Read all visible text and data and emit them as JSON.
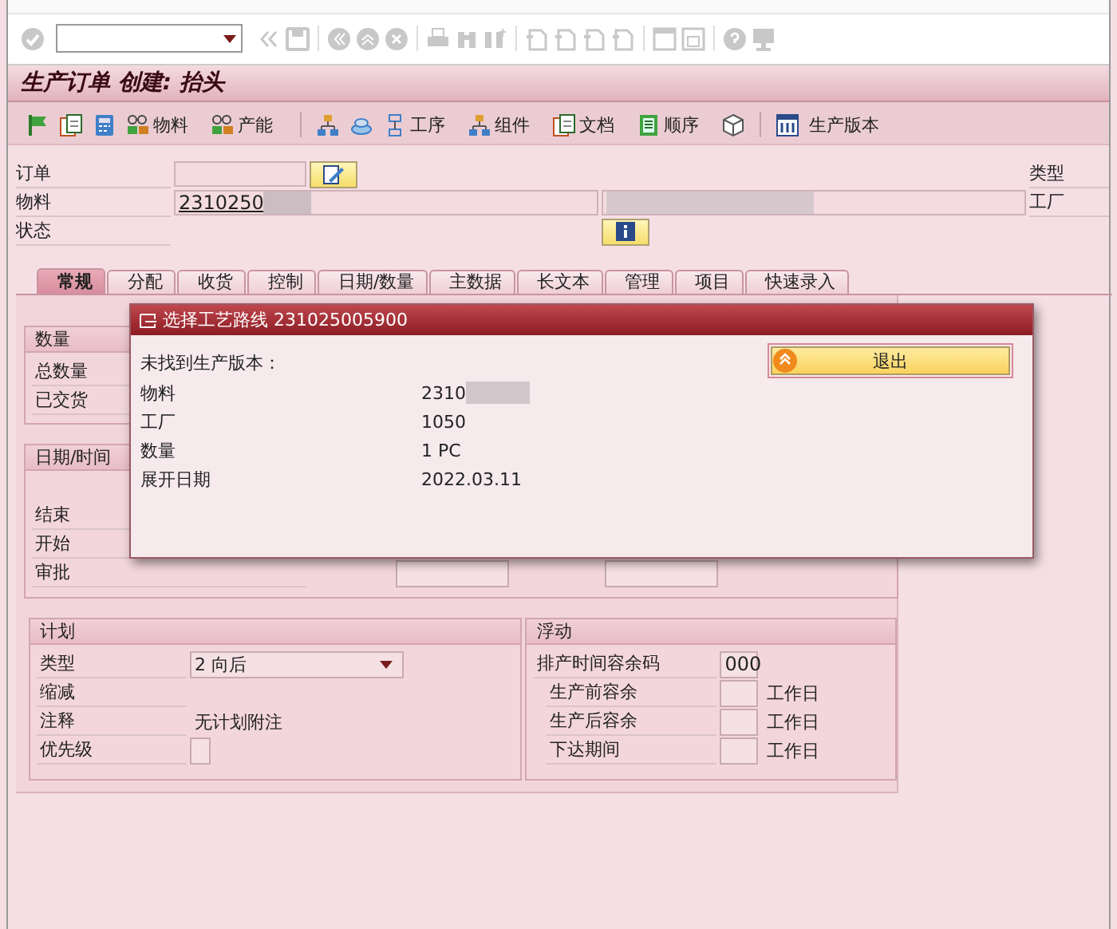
{
  "window": {
    "title": "生产订单 创建: 抬头"
  },
  "app_toolbar": [
    {
      "kind": "icon"
    },
    {
      "kind": "icon"
    },
    {
      "kind": "icon"
    },
    {
      "kind": "button",
      "label": "物料"
    },
    {
      "kind": "button",
      "label": "产能"
    },
    {
      "kind": "separator"
    },
    {
      "kind": "icon"
    },
    {
      "kind": "icon"
    },
    {
      "kind": "button",
      "label": "工序"
    },
    {
      "kind": "button",
      "label": "组件"
    },
    {
      "kind": "button",
      "label": "文档"
    },
    {
      "kind": "button",
      "label": "顺序"
    },
    {
      "kind": "icon"
    },
    {
      "kind": "separator"
    },
    {
      "kind": "icon"
    },
    {
      "kind": "button",
      "label": "生产版本"
    }
  ],
  "header": {
    "order_label": "订单",
    "material_label": "物料",
    "material_value": "2310250",
    "status_label": "状态",
    "right_labels": [
      "类型",
      "工厂"
    ]
  },
  "tabs": [
    {
      "label": "常规",
      "selected": true
    },
    {
      "label": "分配",
      "selected": false
    },
    {
      "label": "收货",
      "selected": false
    },
    {
      "label": "控制",
      "selected": false
    },
    {
      "label": "日期/数量",
      "selected": false
    },
    {
      "label": "主数据",
      "selected": false
    },
    {
      "label": "长文本",
      "selected": false
    },
    {
      "label": "管理",
      "selected": false
    },
    {
      "label": "项目",
      "selected": false
    },
    {
      "label": "快速录入",
      "selected": false
    }
  ],
  "quantity_group": {
    "title": "数量",
    "rows": [
      "总数量",
      "已交货"
    ]
  },
  "dates_group": {
    "title": "日期/时间",
    "rows": [
      {
        "label": "结束",
        "kind": "label"
      },
      {
        "label": "开始",
        "kind": "label"
      },
      {
        "label": "审批",
        "kind": "fields"
      }
    ]
  },
  "plan_group": {
    "title": "计划",
    "rows": [
      {
        "label": "类型",
        "kind": "dropdown",
        "value": "2 向后"
      },
      {
        "label": "缩减",
        "kind": "label"
      },
      {
        "label": "注释",
        "kind": "text",
        "value": "无计划附注"
      },
      {
        "label": "优先级",
        "kind": "field"
      }
    ]
  },
  "float_group": {
    "title": "浮动",
    "rows": [
      {
        "label": "排产时间容余码",
        "kind": "field",
        "value": "000"
      },
      {
        "label": "生产前容余",
        "kind": "unit",
        "unit": "工作日"
      },
      {
        "label": "生产后容余",
        "kind": "unit",
        "unit": "工作日"
      },
      {
        "label": "下达期间",
        "kind": "unit",
        "unit": "工作日"
      }
    ]
  },
  "dialog": {
    "title": "选择工艺路线 231025005900",
    "message": "未找到生产版本：",
    "rows": [
      {
        "label": "物料",
        "value": "2310",
        "blurred": true
      },
      {
        "label": "工厂",
        "value": "1050",
        "blurred": false
      },
      {
        "label": "数量",
        "value": "1 PC",
        "blurred": false
      },
      {
        "label": "展开日期",
        "value": "2022.03.11",
        "blurred": false
      }
    ],
    "exit_button": "退出"
  }
}
